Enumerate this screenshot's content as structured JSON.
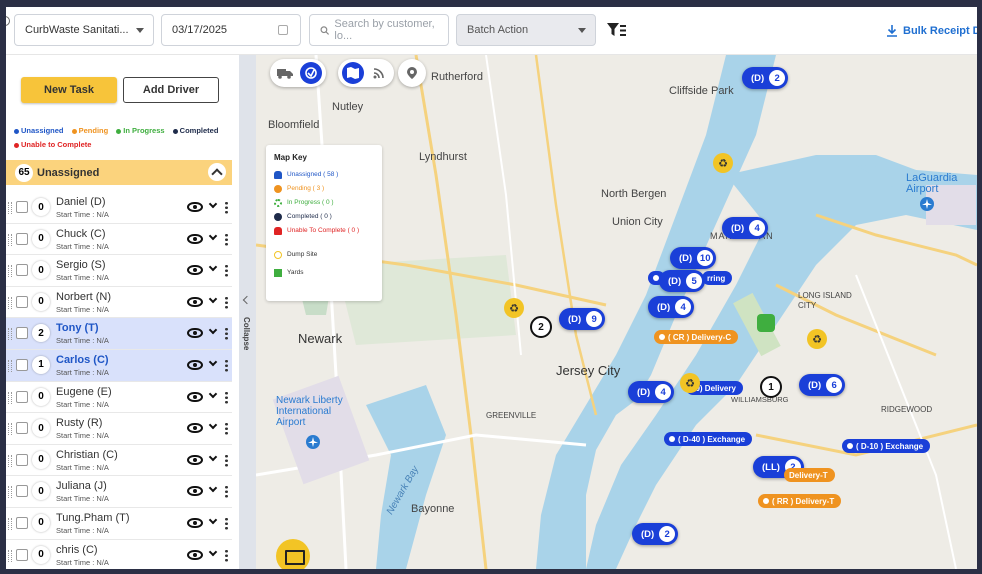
{
  "topbar": {
    "company": "CurbWaste Sanitati...",
    "date": "03/17/2025",
    "search_placeholder": "Search by customer, lo...",
    "batch_action": "Batch Action",
    "bulk_receipt": "Bulk Receipt Do"
  },
  "sidebar": {
    "new_task": "New Task",
    "add_driver": "Add Driver",
    "legend": [
      {
        "label": "Unassigned",
        "color": "#1f56c6"
      },
      {
        "label": "Pending",
        "color": "#ef9320"
      },
      {
        "label": "In Progress",
        "color": "#3fae3f"
      },
      {
        "label": "Completed",
        "color": "#1e2b4a"
      },
      {
        "label": "Unable to Complete",
        "color": "#e02424"
      }
    ],
    "unassigned_count": "65",
    "unassigned_label": "Unassigned",
    "collapse_label": "Collapse",
    "drivers": [
      {
        "count": "0",
        "name": "Daniel (D)",
        "start": "Start Time : N/A"
      },
      {
        "count": "0",
        "name": "Chuck (C)",
        "start": "Start Time : N/A"
      },
      {
        "count": "0",
        "name": "Sergio (S)",
        "start": "Start Time : N/A"
      },
      {
        "count": "0",
        "name": "Norbert (N)",
        "start": "Start Time : N/A"
      },
      {
        "count": "2",
        "name": "Tony (T)",
        "start": "Start Time : N/A"
      },
      {
        "count": "1",
        "name": "Carlos (C)",
        "start": "Start Time : N/A"
      },
      {
        "count": "0",
        "name": "Eugene (E)",
        "start": "Start Time : N/A"
      },
      {
        "count": "0",
        "name": "Rusty (R)",
        "start": "Start Time : N/A"
      },
      {
        "count": "0",
        "name": "Christian (C)",
        "start": "Start Time : N/A"
      },
      {
        "count": "0",
        "name": "Juliana (J)",
        "start": "Start Time : N/A"
      },
      {
        "count": "0",
        "name": "Tung.Pham (T)",
        "start": "Start Time : N/A"
      },
      {
        "count": "0",
        "name": "chris (C)",
        "start": "Start Time : N/A"
      }
    ]
  },
  "map": {
    "key": {
      "title": "Map Key",
      "items": [
        {
          "label": "Unassigned ( 58 )",
          "color": "#1f56c6"
        },
        {
          "label": "Pending ( 3 )",
          "color": "#ef9320"
        },
        {
          "label": "In Progress ( 0 )",
          "color": "#3fae3f"
        },
        {
          "label": "Completed ( 0 )",
          "color": "#1e2b4a"
        },
        {
          "label": "Unable To Complete ( 0 )",
          "color": "#e02424"
        },
        {
          "label": "Dump Site",
          "color": "#f2c425"
        },
        {
          "label": "Yards",
          "color": "#3fae3f"
        }
      ]
    },
    "places": {
      "rutherford": "Rutherford",
      "nutley": "Nutley",
      "bloomfield": "Bloomfield",
      "lyndhurst": "Lyndhurst",
      "cliffside": "Cliffside Park",
      "north_bergen": "North Bergen",
      "union_city": "Union City",
      "manhattan": "MANHATTAN",
      "laguardia": "LaGuardia Airport",
      "newark": "Newark",
      "jersey_city": "Jersey City",
      "long_island_city": "LONG ISLAND CITY",
      "newark_airport": "Newark Liberty International Airport",
      "bayonne": "Bayonne",
      "greenville": "GREENVILLE",
      "williamsburg": "WILLIAMSBURG",
      "ridgewood": "RIDGEWOOD",
      "newark_bay": "Newark Bay"
    },
    "pills": [
      {
        "label": "(D)",
        "count": "2"
      },
      {
        "label": "(D)",
        "count": "4"
      },
      {
        "label": "(D)",
        "count": "10"
      },
      {
        "label": "(D)",
        "count": "5"
      },
      {
        "label": "(D)",
        "count": "4"
      },
      {
        "label": "(D)",
        "count": "9"
      },
      {
        "label": "(D)",
        "count": "4"
      },
      {
        "label": "(D)",
        "count": "6"
      },
      {
        "label": "(LL)",
        "count": "2"
      },
      {
        "label": "(D)",
        "count": "2"
      }
    ],
    "tags": {
      "recurring": "rring",
      "cr_delivery": "( CR ) Delivery-C",
      "d30_delivery": "30) Delivery",
      "d40_exchange": "( D-40 ) Exchange",
      "d10_exchange": "( D-10 ) Exchange",
      "delivery_t": "Delivery-T",
      "rr_delivery": "( RR ) Delivery-T"
    },
    "pins": [
      "2",
      "1"
    ]
  }
}
